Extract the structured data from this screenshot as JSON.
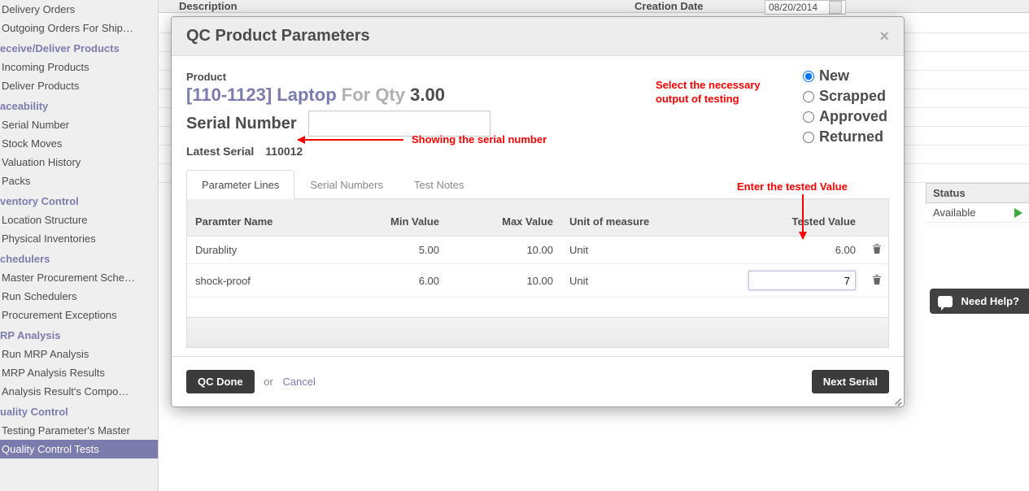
{
  "sidebar": {
    "groups": [
      {
        "title": null,
        "items": [
          "Delivery Orders",
          "Outgoing Orders For Ship…"
        ]
      },
      {
        "title": "eceive/Deliver Products",
        "items": [
          "Incoming Products",
          "Deliver Products"
        ]
      },
      {
        "title": "aceability",
        "items": [
          "Serial Number",
          "Stock Moves",
          "Valuation History",
          "Packs"
        ]
      },
      {
        "title": "ventory Control",
        "items": [
          "Location Structure",
          "Physical Inventories"
        ]
      },
      {
        "title": "chedulers",
        "items": [
          "Master Procurement Sche…",
          "Run Schedulers",
          "Procurement Exceptions"
        ]
      },
      {
        "title": "RP Analysis",
        "items": [
          "Run MRP Analysis",
          "MRP Analysis Results",
          "Analysis Result's Compo…"
        ]
      },
      {
        "title": "uality Control",
        "items": [
          "Testing Parameter's Master",
          "Quality Control Tests"
        ]
      }
    ]
  },
  "background": {
    "description_label": "Description",
    "creation_date_label": "Creation Date",
    "creation_date_value": "08/20/2014",
    "status_header": "Status",
    "status_value": "Available"
  },
  "help_button": "Need Help?",
  "modal": {
    "title": "QC Product Parameters",
    "product_label": "Product",
    "product_name": "[110-1123] Laptop",
    "for_qty_label": "For Qty",
    "qty": "3.00",
    "serial_label": "Serial Number",
    "serial_value": "",
    "latest_label": "Latest Serial",
    "latest_value": "110012",
    "status_options": [
      "New",
      "Scrapped",
      "Approved",
      "Returned"
    ],
    "status_selected": "New",
    "tabs": [
      "Parameter Lines",
      "Serial Numbers",
      "Test Notes"
    ],
    "active_tab": "Parameter Lines",
    "columns": {
      "name": "Paramter Name",
      "min": "Min Value",
      "max": "Max Value",
      "uom": "Unit of measure",
      "tested": "Tested Value"
    },
    "rows": [
      {
        "name": "Durablity",
        "min": "5.00",
        "max": "10.00",
        "uom": "Unit",
        "tested": "6.00",
        "active": false
      },
      {
        "name": "shock-proof",
        "min": "6.00",
        "max": "10.00",
        "uom": "Unit",
        "tested": "7",
        "active": true
      }
    ],
    "footer": {
      "qc_done": "QC Done",
      "or": "or",
      "cancel": "Cancel",
      "next_serial": "Next Serial"
    }
  },
  "annotations": {
    "select_output": "Select the necessary\noutput of testing",
    "showing_serial": "Showing the serial number",
    "enter_tested": "Enter the tested Value"
  }
}
